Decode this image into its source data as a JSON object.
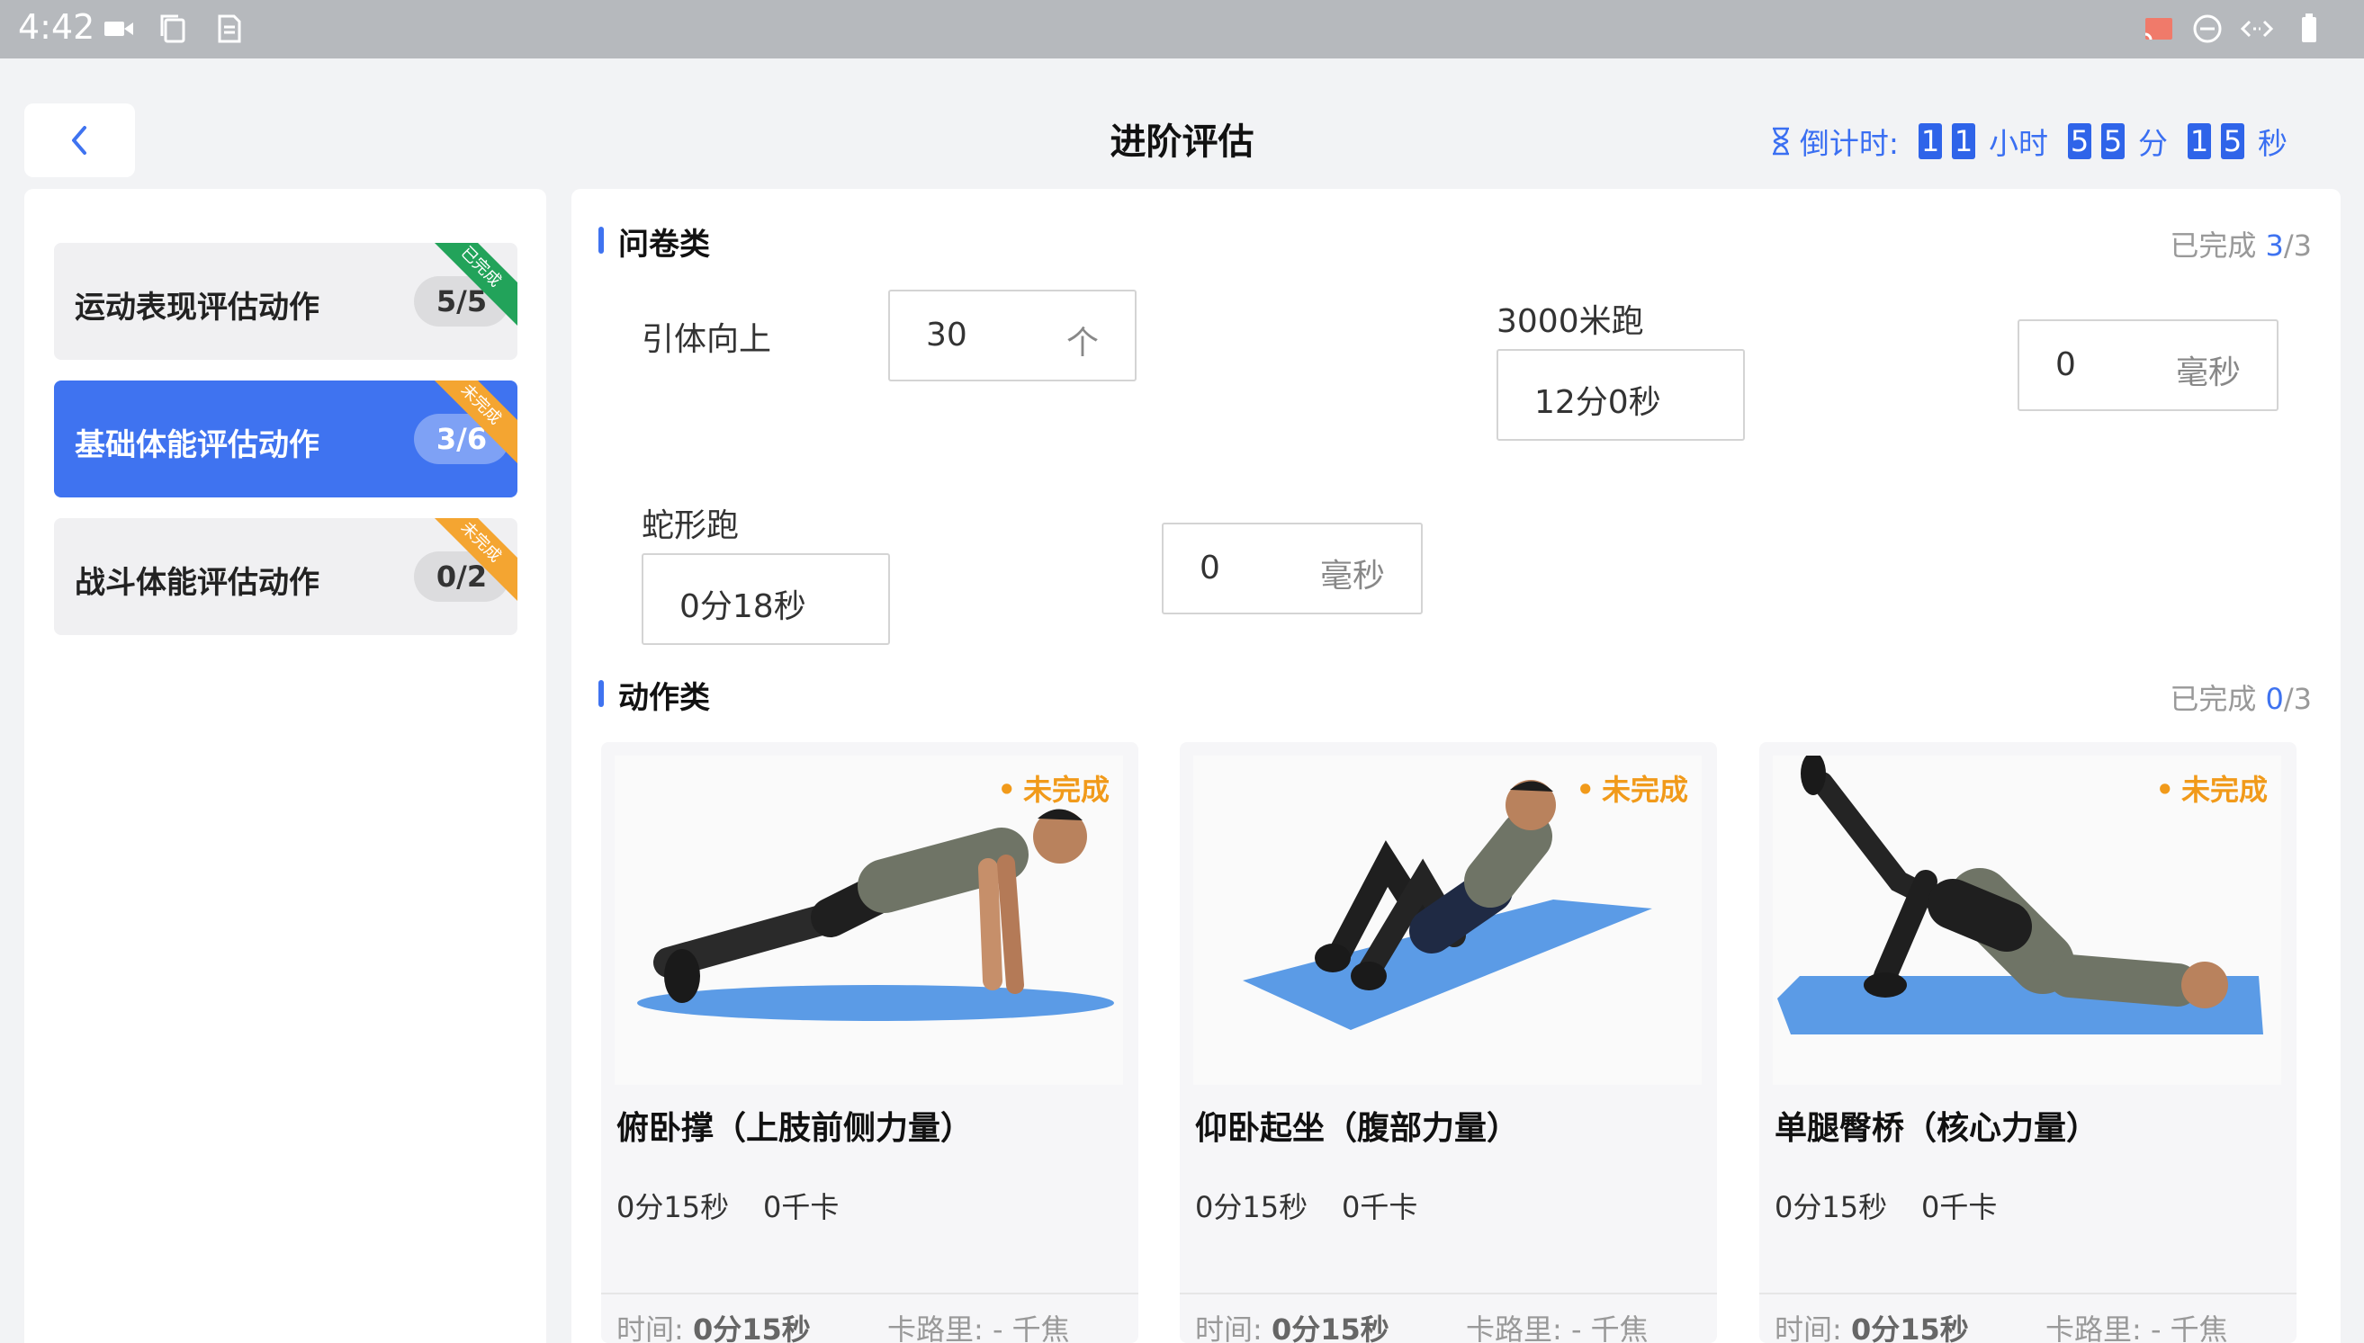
{
  "status_bar": {
    "time": "4:42"
  },
  "header": {
    "title": "进阶评估",
    "countdown": {
      "label": "倒计时:",
      "hours": [
        "1",
        "1"
      ],
      "hours_unit": "小时",
      "minutes": [
        "5",
        "5"
      ],
      "minutes_unit": "分",
      "seconds": [
        "1",
        "5"
      ],
      "seconds_unit": "秒"
    }
  },
  "sidebar": {
    "items": [
      {
        "label": "运动表现评估动作",
        "count": "5/5",
        "ribbon": "已完成"
      },
      {
        "label": "基础体能评估动作",
        "count": "3/6",
        "ribbon": "未完成"
      },
      {
        "label": "战斗体能评估动作",
        "count": "0/2",
        "ribbon": "未完成"
      }
    ]
  },
  "questionnaire": {
    "title": "问卷类",
    "completed_label": "已完成",
    "completed_num": "3",
    "completed_total": "/3",
    "pullup": {
      "label": "引体向上",
      "value": "30",
      "unit": "个"
    },
    "run3000": {
      "label": "3000米跑",
      "value": "12分0秒",
      "ms_value": "0",
      "ms_unit": "毫秒"
    },
    "snake": {
      "label": "蛇形跑",
      "value": "0分18秒",
      "ms_value": "0",
      "ms_unit": "毫秒"
    }
  },
  "actions": {
    "title": "动作类",
    "completed_label": "已完成",
    "completed_num": "0",
    "completed_total": "/3",
    "cards": [
      {
        "name": "俯卧撑（上肢前侧力量）",
        "status": "未完成",
        "duration": "0分15秒",
        "kcal": "0千卡",
        "time_label": "时间:",
        "time_value": "0分15秒",
        "cal_label": "卡路里: - 千焦"
      },
      {
        "name": "仰卧起坐（腹部力量）",
        "status": "未完成",
        "duration": "0分15秒",
        "kcal": "0千卡",
        "time_label": "时间:",
        "time_value": "0分15秒",
        "cal_label": "卡路里: - 千焦"
      },
      {
        "name": "单腿臀桥（核心力量）",
        "status": "未完成",
        "duration": "0分15秒",
        "kcal": "0千卡",
        "time_label": "时间:",
        "time_value": "0分15秒",
        "cal_label": "卡路里: - 千焦"
      }
    ]
  },
  "colors": {
    "accent": "#3f73f0",
    "done": "#22a35a",
    "todo": "#f4a531",
    "status_orange": "#f19a1a"
  }
}
